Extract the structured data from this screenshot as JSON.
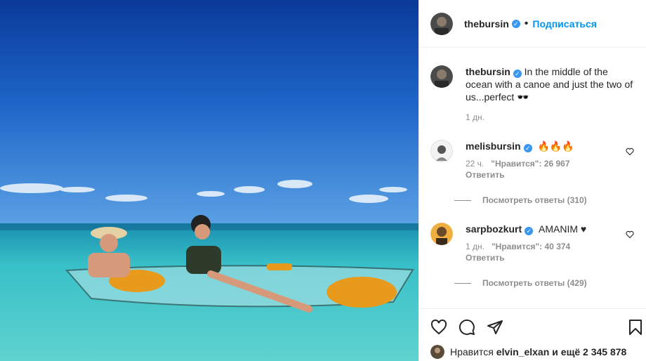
{
  "post": {
    "author": "thebursin",
    "follow_label": "Подписаться",
    "separator": "•",
    "caption": "In the middle of the ocean with a canoe and just the two of us...perfect 🕶️",
    "caption_time": "1 дн."
  },
  "comments": [
    {
      "user": "melisbursin",
      "text": "🔥🔥🔥",
      "time": "22 ч.",
      "likes": "\"Нравится\": 26 967",
      "reply": "Ответить",
      "view_replies": "Посмотреть ответы (310)"
    },
    {
      "user": "sarpbozkurt",
      "text": "AMANIM ♥",
      "time": "1 дн.",
      "likes": "\"Нравится\": 40 374",
      "reply": "Ответить",
      "view_replies": "Посмотреть ответы (429)"
    }
  ],
  "footer": {
    "likes_prefix": "Нравится",
    "likes_user": "elvin_elxan",
    "likes_suffix": "и ещё 2 345 878"
  },
  "icons": {
    "verified": "verified-badge-icon",
    "like": "heart-icon",
    "comment": "comment-icon",
    "share": "paper-plane-icon",
    "save": "bookmark-icon"
  },
  "colors": {
    "accent": "#0095f6",
    "verified": "#3897f0",
    "muted": "#8e8e8e"
  }
}
